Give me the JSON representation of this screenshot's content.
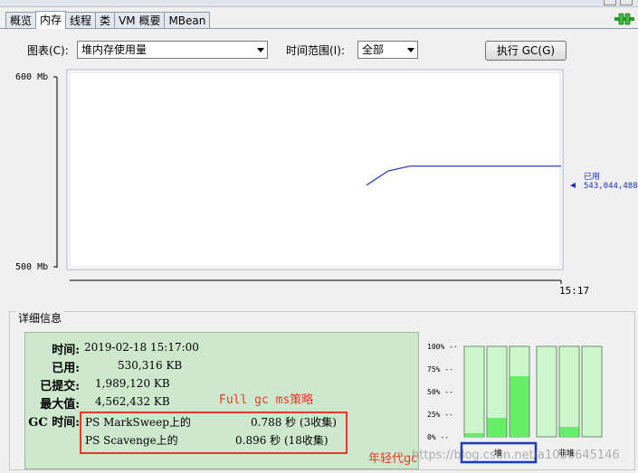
{
  "tabs": [
    "概览",
    "内存",
    "线程",
    "类",
    "VM 概要",
    "MBean"
  ],
  "active_tab": "内存",
  "controls": {
    "chart_label": "图表(C):",
    "chart_value": "堆内存使用量",
    "range_label": "时间范围(I):",
    "range_value": "全部",
    "gc_button": "执行 GC(G)"
  },
  "chart_data": {
    "type": "line",
    "y_tick_labels": [
      "600 Mb",
      "500 Mb"
    ],
    "x_tick_label": "15:17",
    "ylim_mb": [
      500,
      600
    ],
    "series": [
      {
        "name": "已用",
        "values_mb": [
          543.0,
          550.5,
          553.0,
          553.0,
          553.0,
          553.0,
          553.0,
          553.0,
          553.0,
          553.0
        ]
      }
    ],
    "current_label": "已用",
    "current_value": "543,044,488"
  },
  "detail": {
    "title": "详细信息",
    "time_label": "时间:",
    "time_value": "2019-02-18 15:17:00",
    "used_label": "已用:",
    "used_value": "530,316 KB",
    "committed_label": "已提交:",
    "committed_value": "1,989,120 KB",
    "max_label": "最大值:",
    "max_value": "4,562,432 KB",
    "gc_label": "GC 时间:",
    "gc_rows": [
      {
        "name": "PS MarkSweep上的",
        "time": "0.788 秒 (3收集)"
      },
      {
        "name": "PS Scavenge上的",
        "time": "0.896 秒 (18收集)"
      }
    ]
  },
  "annotations": {
    "full_gc": "Full gc ms策略",
    "young_gc": "年轻代gc"
  },
  "bar_chart": {
    "ticks": [
      "100%",
      "75%",
      "50%",
      "25%",
      "0%"
    ],
    "heap_bars_pct": [
      4,
      21,
      67
    ],
    "nonheap_bars_pct": [
      0,
      11,
      0
    ],
    "heap_label": "堆",
    "nonheap_label": "非堆",
    "colors": {
      "used": "#66ee66",
      "empty": "#ccf7cc",
      "border": "#6e8a6e",
      "selected": "#1a3db8"
    }
  },
  "watermark": "https://blog.csdn.net/a1036645146"
}
